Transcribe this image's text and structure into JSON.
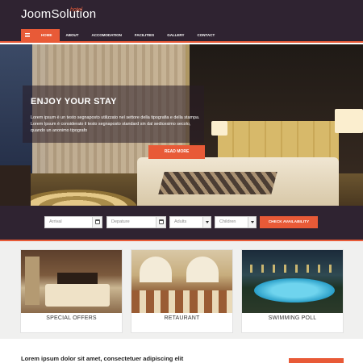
{
  "brand": {
    "logo_text": "JoomSolution",
    "logo_sup": "hotel"
  },
  "nav": {
    "items": [
      {
        "label": "HOME",
        "active": true
      },
      {
        "label": "ABOUT",
        "active": false
      },
      {
        "label": "ACCOMODATION",
        "active": false
      },
      {
        "label": "FACILITIES",
        "active": false
      },
      {
        "label": "GALLERY",
        "active": false
      },
      {
        "label": "CONTACT",
        "active": false
      }
    ],
    "menu_icon": "hamburger-icon"
  },
  "hero": {
    "title": "ENJOY YOUR STAY",
    "text": "Lorem ipsum è un testo segnaposto utilizzato nel settore della tipografia e della stampa. Lorem Ipsum è considerato il testo segnaposto standard sin dal sedicesimo secolo, quando un anonimo tipografo",
    "button_label": "READ MORE"
  },
  "booking": {
    "arrival_placeholder": "Arrival",
    "departure_placeholder": "Depature",
    "adults_placeholder": "Adults",
    "children_placeholder": "Children",
    "button_label": "CHECK AVAILABILITY"
  },
  "features": [
    {
      "label": "SPECIAL OFFERS"
    },
    {
      "label": "RETAURANT"
    },
    {
      "label": "SWIMMING POLL"
    }
  ],
  "bottom": {
    "title": "Lorem ipsum dolor sit amet, consectetuer adipiscing elit"
  },
  "colors": {
    "accent": "#e85a37",
    "dark": "#2f2331",
    "panel": "#f0f0ef"
  }
}
